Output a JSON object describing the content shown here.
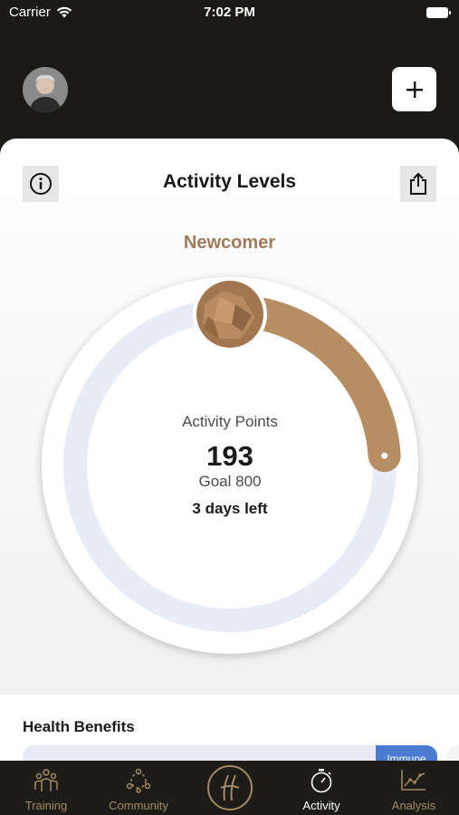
{
  "status_bar": {
    "carrier": "Carrier",
    "time": "7:02 PM"
  },
  "header": {
    "avatar_icon": "user-avatar",
    "add_icon": "plus-icon"
  },
  "card": {
    "title": "Activity Levels",
    "info_icon": "info-icon",
    "share_icon": "share-icon",
    "level_name": "Newcomer",
    "points_label": "Activity Points",
    "points_value": "193",
    "goal_label": "Goal 800",
    "days_left": "3 days left",
    "progress_fraction": 0.24,
    "colors": {
      "progress": "#b78d64",
      "track": "#e8ecf4",
      "level": "#a07a58"
    }
  },
  "health": {
    "title": "Health Benefits",
    "tag": "Immune"
  },
  "tabs": [
    {
      "label": "Training",
      "icon": "training-icon",
      "active": false
    },
    {
      "label": "Community",
      "icon": "community-icon",
      "active": false
    },
    {
      "label": "",
      "icon": "logo-icon",
      "active": false
    },
    {
      "label": "Activity",
      "icon": "stopwatch-icon",
      "active": true
    },
    {
      "label": "Analysis",
      "icon": "analysis-chart-icon",
      "active": false
    }
  ],
  "colors": {
    "dark_bg": "#1c1a17",
    "accent_gold": "#a38a63"
  }
}
